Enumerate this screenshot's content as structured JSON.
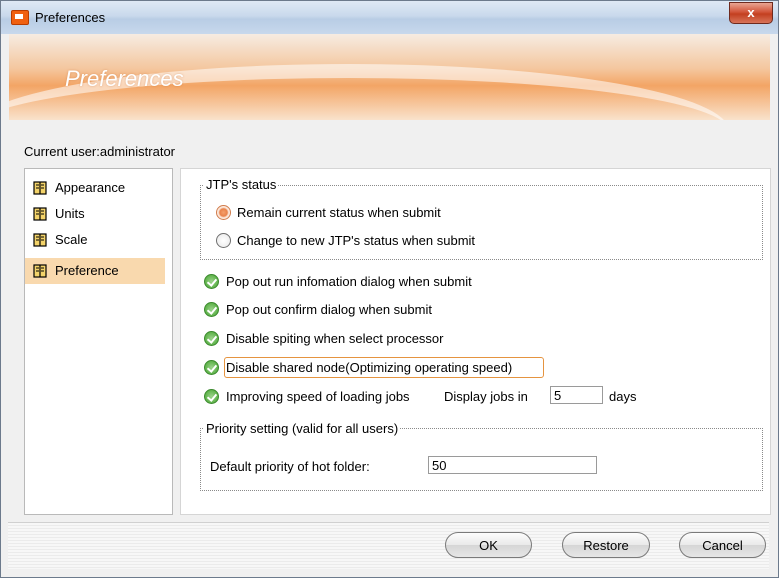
{
  "window": {
    "title": "Preferences",
    "close_glyph": "x"
  },
  "header": {
    "title": "Preferences"
  },
  "current_user": "Current user:administrator",
  "sidebar": {
    "items": [
      {
        "label": "Appearance",
        "icon": "book-icon",
        "selected": false
      },
      {
        "label": "Units",
        "icon": "book-icon",
        "selected": false
      },
      {
        "label": "Scale",
        "icon": "book-icon",
        "selected": false
      },
      {
        "label": "Preference",
        "icon": "book-icon",
        "selected": true
      }
    ]
  },
  "jtp_status": {
    "legend": "JTP's status",
    "options": [
      {
        "label": "Remain current status when submit",
        "checked": true
      },
      {
        "label": "Change to new JTP's status when submit",
        "checked": false
      }
    ]
  },
  "checkboxes": [
    {
      "label": "Pop out run infomation dialog when submit",
      "checked": true
    },
    {
      "label": "Pop out confirm dialog when submit",
      "checked": true
    },
    {
      "label": "Disable spiting when select processor",
      "checked": true
    },
    {
      "label": "Disable shared node(Optimizing operating speed)",
      "checked": true
    },
    {
      "label": "Improving speed of loading jobs",
      "checked": true
    }
  ],
  "display_jobs": {
    "prefix": "Display jobs in",
    "value": "5",
    "suffix": "days"
  },
  "priority": {
    "legend": "Priority setting (valid for all users)",
    "label": "Default priority of hot folder:",
    "value": "50"
  },
  "buttons": {
    "ok": "OK",
    "restore": "Restore",
    "cancel": "Cancel"
  },
  "colors": {
    "selection": "#f9d9ae",
    "accent_orange": "#f06010",
    "check_green": "#5eb24a"
  }
}
